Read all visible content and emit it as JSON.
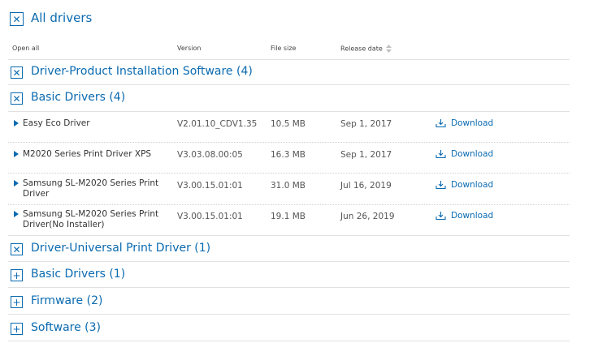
{
  "colors": {
    "accent": "#0a6ab0",
    "divider": "#e1e1e1",
    "text": "#333333"
  },
  "header": {
    "title": "All drivers",
    "title_icon": "close-icon",
    "columns": {
      "open_all": "Open all",
      "version": "Version",
      "file_size": "File size",
      "release_date": "Release date",
      "sort_icon": "sort-icon"
    }
  },
  "sections": [
    {
      "title": "Driver-Product Installation Software (4)",
      "icon": "close-icon",
      "subsections": [
        {
          "title": "Basic Drivers (4)",
          "icon": "close-icon",
          "rows": [
            {
              "name": "Easy Eco Driver",
              "version": "V2.01.10_CDV1.35",
              "size": "10.5 MB",
              "date": "Sep 1, 2017",
              "action": "Download"
            },
            {
              "name": "M2020 Series Print Driver XPS",
              "version": "V3.03.08.00:05",
              "size": "16.3 MB",
              "date": "Sep 1, 2017",
              "action": "Download"
            },
            {
              "name": "Samsung SL-M2020 Series Print Driver",
              "version": "V3.00.15.01:01",
              "size": "31.0 MB",
              "date": "Jul 16, 2019",
              "action": "Download"
            },
            {
              "name": "Samsung SL-M2020 Series Print Driver(No Installer)",
              "version": "V3.00.15.01:01",
              "size": "19.1 MB",
              "date": "Jun 26, 2019",
              "action": "Download"
            }
          ]
        }
      ]
    },
    {
      "title": "Driver-Universal Print Driver (1)",
      "icon": "close-icon",
      "subsections": [
        {
          "title": "Basic Drivers (1)",
          "icon": "plus-icon"
        }
      ]
    },
    {
      "title": "Firmware (2)",
      "icon": "plus-icon"
    },
    {
      "title": "Software (3)",
      "icon": "plus-icon"
    }
  ]
}
